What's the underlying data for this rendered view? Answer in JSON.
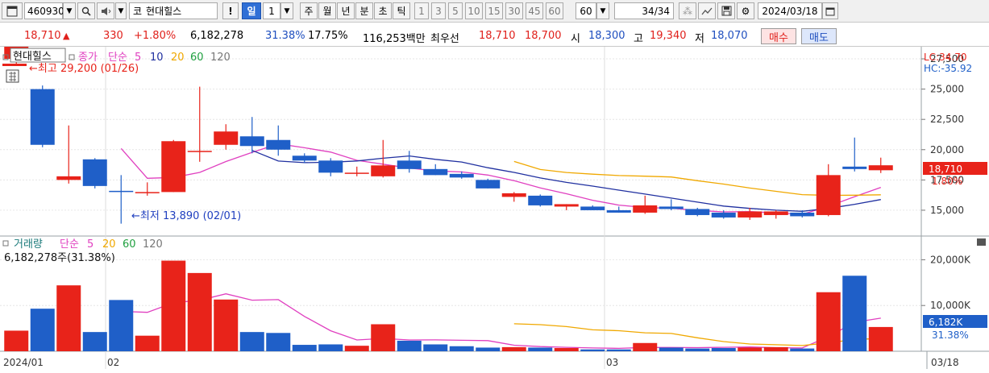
{
  "toolbar": {
    "stock_code": "460930",
    "market_prefix": "코",
    "stock_name": "현대힐스",
    "exclaim": "!",
    "period_day": "일",
    "period_num": "1",
    "periods": [
      "주",
      "월",
      "년",
      "분",
      "초",
      "틱"
    ],
    "minutes": [
      "1",
      "3",
      "5",
      "10",
      "15",
      "30",
      "45",
      "60"
    ],
    "minute_select": "60",
    "count": "34",
    "count_total": "/34",
    "date": "2024/03/18"
  },
  "quote": {
    "price": "18,710",
    "change": "330",
    "change_pct": "+1.80%",
    "volume": "6,182,278",
    "vol_ratio": "31.38%",
    "turnover": "17.75%",
    "amount": "116,253백만",
    "best_label": "최우선",
    "ask": "18,710",
    "bid": "18,700",
    "open_label": "시",
    "open": "18,300",
    "high_label": "고",
    "high": "19,340",
    "low_label": "저",
    "low": "18,070",
    "buy_label": "매수",
    "sell_label": "매도"
  },
  "colors": {
    "up": "#e8231a",
    "down": "#1f5fc8",
    "ma5": "#e040c0",
    "ma10": "#2030a0",
    "ma20": "#f0a800",
    "ma60": "#20a040"
  },
  "legend": {
    "name": "현대힐스",
    "close_label": "종가",
    "ma_label": "단순",
    "ma_periods": [
      "5",
      "10",
      "20",
      "60",
      "120"
    ],
    "vol_label": "거래량",
    "vol_ma_label": "단순",
    "vol_ma_periods": [
      "5",
      "20",
      "60",
      "120"
    ],
    "vol_value": "6,182,278주(31.38%)"
  },
  "annotations": {
    "high_text": "←최고 29,200 (01/26)",
    "low_text": "←최저 13,890 (02/01)",
    "lc": "LC:34.70",
    "hc": "HC:-35.92",
    "price_tag": "18,710",
    "price_pct": "1.80%",
    "vol_tag": "6,182K",
    "vol_pct": "31.38%"
  },
  "x_labels": [
    "2024/01",
    "02",
    "03",
    "03/18"
  ],
  "chart_data": [
    {
      "type": "candlestick",
      "y_ticks": [
        "27,500",
        "25,000",
        "22,500",
        "20,000",
        "17,500",
        "15,000"
      ],
      "ylim": [
        13000,
        28500
      ],
      "candles": [
        {
          "o": 27500,
          "h": 29200,
          "l": 27000,
          "c": 28800
        },
        {
          "o": 25000,
          "h": 25300,
          "l": 20200,
          "c": 20400
        },
        {
          "o": 17500,
          "h": 22000,
          "l": 17200,
          "c": 17800
        },
        {
          "o": 19200,
          "h": 19300,
          "l": 16800,
          "c": 17000
        },
        {
          "o": 16600,
          "h": 17900,
          "l": 13890,
          "c": 16500
        },
        {
          "o": 16400,
          "h": 17300,
          "l": 16200,
          "c": 16500
        },
        {
          "o": 16500,
          "h": 20800,
          "l": 16500,
          "c": 20700
        },
        {
          "o": 19800,
          "h": 25200,
          "l": 19000,
          "c": 19900
        },
        {
          "o": 20400,
          "h": 22100,
          "l": 20000,
          "c": 21500
        },
        {
          "o": 21100,
          "h": 22700,
          "l": 19700,
          "c": 20300
        },
        {
          "o": 20800,
          "h": 22000,
          "l": 19500,
          "c": 20000
        },
        {
          "o": 19500,
          "h": 19700,
          "l": 18900,
          "c": 19100
        },
        {
          "o": 19100,
          "h": 19300,
          "l": 17800,
          "c": 18100
        },
        {
          "o": 18000,
          "h": 18600,
          "l": 17800,
          "c": 18100
        },
        {
          "o": 17800,
          "h": 20800,
          "l": 17700,
          "c": 18700
        },
        {
          "o": 19100,
          "h": 19900,
          "l": 18100,
          "c": 18400
        },
        {
          "o": 18400,
          "h": 18800,
          "l": 17900,
          "c": 17900
        },
        {
          "o": 18000,
          "h": 18200,
          "l": 17600,
          "c": 17700
        },
        {
          "o": 17500,
          "h": 17600,
          "l": 16800,
          "c": 16800
        },
        {
          "o": 16100,
          "h": 16500,
          "l": 15700,
          "c": 16400
        },
        {
          "o": 16200,
          "h": 16300,
          "l": 15300,
          "c": 15400
        },
        {
          "o": 15300,
          "h": 15500,
          "l": 15000,
          "c": 15500
        },
        {
          "o": 15300,
          "h": 15400,
          "l": 15000,
          "c": 15000
        },
        {
          "o": 15000,
          "h": 15300,
          "l": 14800,
          "c": 14800
        },
        {
          "o": 14800,
          "h": 16200,
          "l": 14700,
          "c": 15400
        },
        {
          "o": 15300,
          "h": 15900,
          "l": 15000,
          "c": 15100
        },
        {
          "o": 15100,
          "h": 15200,
          "l": 14500,
          "c": 14600
        },
        {
          "o": 14800,
          "h": 15000,
          "l": 14300,
          "c": 14400
        },
        {
          "o": 14400,
          "h": 15200,
          "l": 14200,
          "c": 14900
        },
        {
          "o": 14600,
          "h": 15000,
          "l": 14300,
          "c": 14900
        },
        {
          "o": 14800,
          "h": 15000,
          "l": 14400,
          "c": 14500
        },
        {
          "o": 14600,
          "h": 18800,
          "l": 14500,
          "c": 17900
        },
        {
          "o": 18600,
          "h": 21000,
          "l": 18200,
          "c": 18400
        },
        {
          "o": 18300,
          "h": 19340,
          "l": 18070,
          "c": 18710
        }
      ]
    },
    {
      "type": "bar",
      "y_ticks": [
        "20,000K",
        "10,000K"
      ],
      "ylim": [
        0,
        25000
      ],
      "values": [
        4500,
        9300,
        14400,
        4200,
        11200,
        3400,
        19800,
        17100,
        11300,
        4200,
        4000,
        1400,
        1500,
        1200,
        5900,
        2300,
        1500,
        1100,
        800,
        900,
        800,
        700,
        400,
        400,
        1800,
        800,
        600,
        700,
        800,
        900,
        600,
        12900,
        16500,
        5300
      ]
    }
  ]
}
